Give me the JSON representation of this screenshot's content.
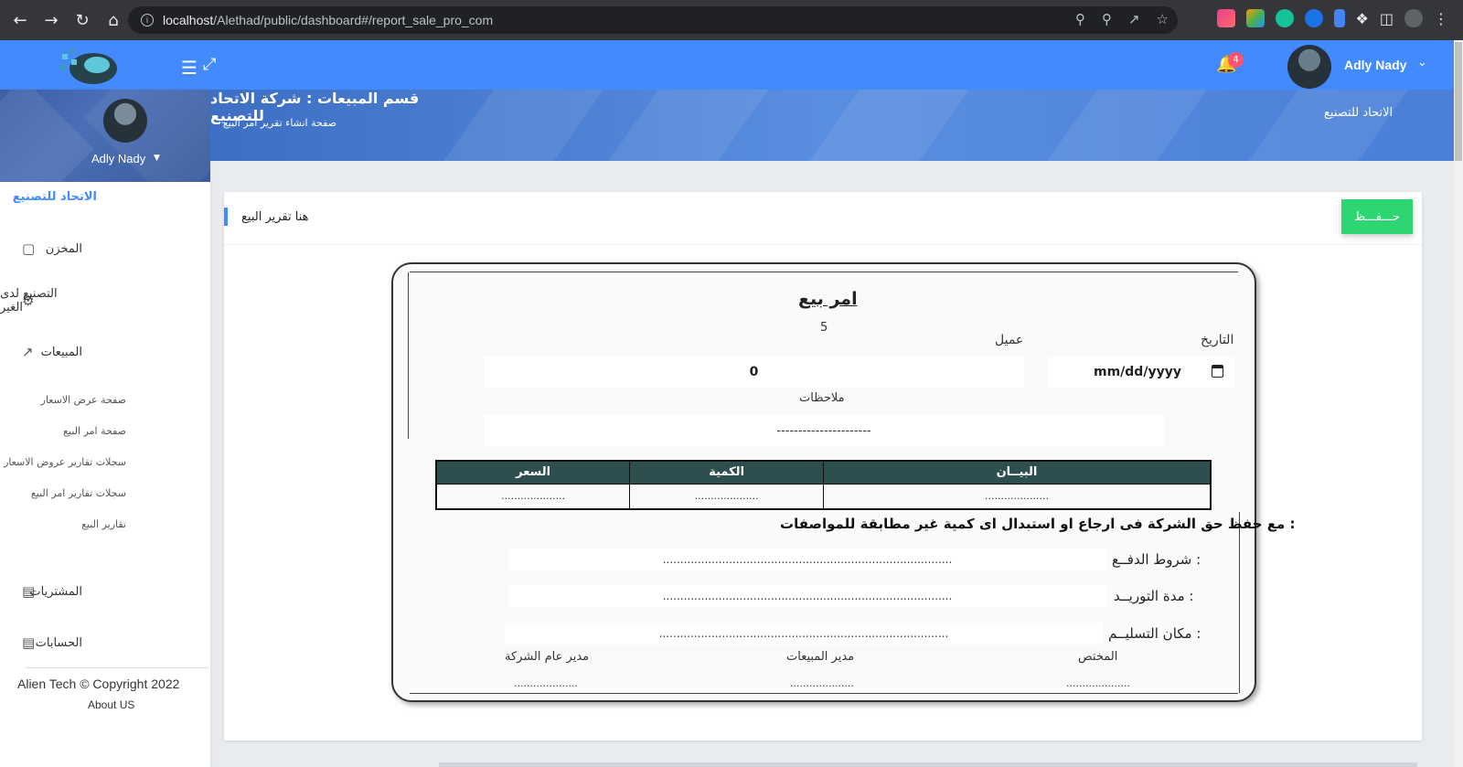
{
  "browser": {
    "url_host": "localhost",
    "url_path": "/Alethad/public/dashboard#/report_sale_pro_com"
  },
  "topbar": {
    "notification_count": "4",
    "user_name": "Adly Nady"
  },
  "sidebar": {
    "user_name": "Adly Nady",
    "brand": "الاتحاد للتصنيع",
    "items": [
      {
        "label": "المخزن",
        "icon": "box-icon"
      },
      {
        "label": "التصنيع لدى الغير",
        "icon": "gear-icon"
      },
      {
        "label": "المبيعات",
        "icon": "chart-line-icon"
      }
    ],
    "sub_items": [
      "صفحة عرض الاسعار",
      "صفحة امر البيع",
      "سجلات تقارير عروض الاسعار",
      "سجلات تقارير امر البيع",
      "تقارير البيع"
    ],
    "lower_items": [
      {
        "label": "المشتريات",
        "icon": "card-icon"
      },
      {
        "label": "الحسابات",
        "icon": "card-icon"
      }
    ],
    "copyright": "Alien Tech © Copyright 2022",
    "about": "About US"
  },
  "page_header": {
    "title": "قسم المبيعات : شركة الاتحاد للتصنيع",
    "subtitle": "صفحة انشاء تقرير امر البيع",
    "breadcrumb": "الاتحاد للتصنيع"
  },
  "card": {
    "title": "هنا تقرير البيع",
    "save_label": "حـــفـــظ"
  },
  "document": {
    "title": "امر بيع",
    "number": "5",
    "date_label": "التاريخ",
    "date_placeholder": "mm/dd/yyyy",
    "client_label": "عميل",
    "client_value": "0",
    "notes_label": "ملاحظات",
    "notes_value": "----------------------",
    "table": {
      "headers": [
        "السعر",
        "الكمية",
        "البيــان"
      ],
      "row": [
        "....................",
        "....................",
        "...................."
      ]
    },
    "terms_title": "مع حفظ حق الشركة فى ارجاع او استبدال اى كمية غير مطابقة للمواصفات :",
    "terms": [
      {
        "label": "شروط الدفــع :",
        "value": "..................................................................................."
      },
      {
        "label": "مدة التوريــد :",
        "value": "..................................................................................."
      },
      {
        "label": "مكان التسليــم :",
        "value": "..................................................................................."
      }
    ],
    "signatures": [
      {
        "label": "المختص",
        "dots": "...................."
      },
      {
        "label": "مدير المبيعات",
        "dots": "...................."
      },
      {
        "label": "مدير عام الشركة",
        "dots": "...................."
      }
    ]
  },
  "colors": {
    "primary": "#448aff",
    "save_button": "#2ed573",
    "table_header": "#2e4f4f"
  }
}
